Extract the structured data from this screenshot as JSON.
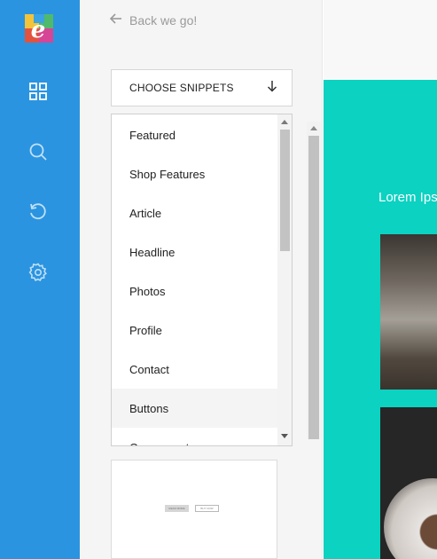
{
  "sidebar": {
    "logo_letter": "e",
    "icons": [
      "grid-icon",
      "search-icon",
      "history-icon",
      "gear-icon"
    ]
  },
  "panel": {
    "back_label": "Back we go!",
    "chooser_label": "CHOOSE SNIPPETS",
    "categories": [
      "Featured",
      "Shop Features",
      "Article",
      "Headline",
      "Photos",
      "Profile",
      "Contact",
      "Buttons",
      "Components"
    ],
    "highlighted_category": "Buttons",
    "preview": {
      "button1_label": "READ MORE",
      "button2_label": "BUY NOW"
    }
  },
  "canvas": {
    "heading_text": "Lorem Ips"
  },
  "colors": {
    "rail": "#2b94e0",
    "canvas_bg": "#0bd2c1"
  }
}
